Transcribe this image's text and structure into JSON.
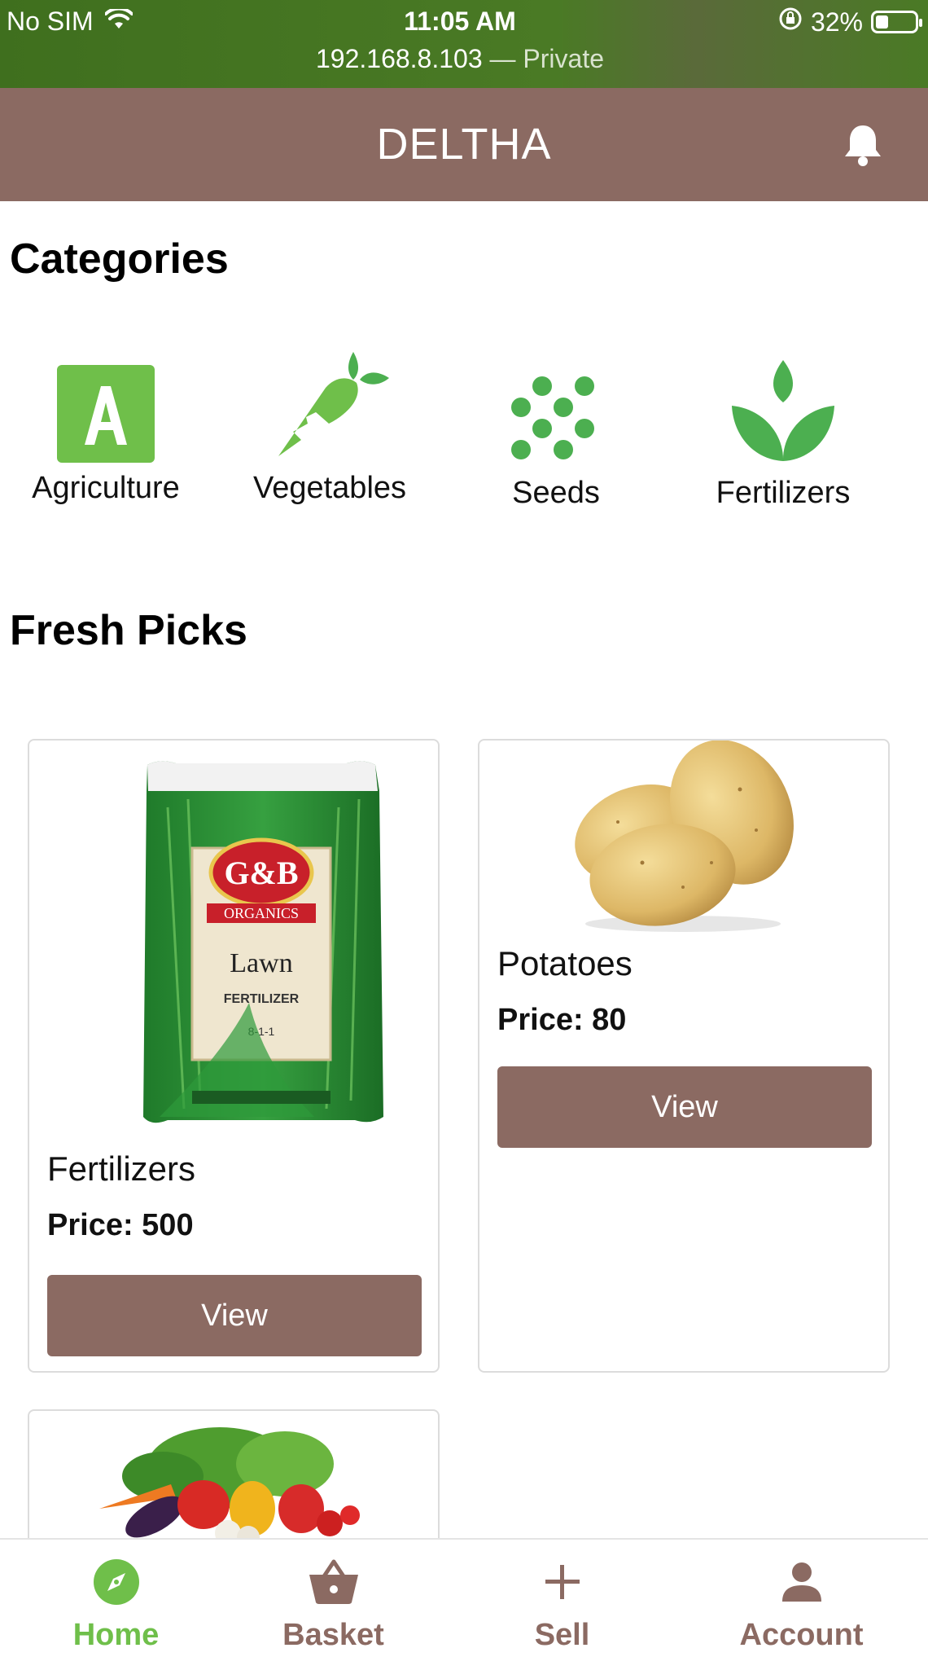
{
  "status_bar": {
    "carrier": "No SIM",
    "time": "11:05 AM",
    "battery": "32%",
    "battery_level": 0.32,
    "url_host": "192.168.8.103",
    "url_mode": "— Private"
  },
  "header": {
    "title": "DELTHA",
    "icon": "bell-icon"
  },
  "categories": {
    "title": "Categories",
    "items": [
      {
        "label": "Agriculture",
        "icon": "agriculture-icon"
      },
      {
        "label": "Vegetables",
        "icon": "carrot-icon"
      },
      {
        "label": "Seeds",
        "icon": "seeds-icon"
      },
      {
        "label": "Fertilizers",
        "icon": "sprout-icon"
      }
    ]
  },
  "fresh_picks": {
    "title": "Fresh Picks",
    "items": [
      {
        "name": "Fertilizers",
        "price": "Price: 500",
        "button": "View",
        "image": "fertilizer-bag-image"
      },
      {
        "name": "Potatoes",
        "price": "Price: 80",
        "button": "View",
        "image": "potatoes-image"
      },
      {
        "name": "",
        "price": "",
        "button": "",
        "image": "vegetables-image"
      }
    ]
  },
  "tab_bar": {
    "items": [
      {
        "label": "Home",
        "icon": "compass-icon",
        "active": true
      },
      {
        "label": "Basket",
        "icon": "basket-icon",
        "active": false
      },
      {
        "label": "Sell",
        "icon": "plus-icon",
        "active": false
      },
      {
        "label": "Account",
        "icon": "person-icon",
        "active": false
      }
    ]
  },
  "colors": {
    "status_bar": "#4a7a25",
    "brand": "#8b6a62",
    "accent_green": "#6fbf4a",
    "icon_green": "#4caf50"
  }
}
